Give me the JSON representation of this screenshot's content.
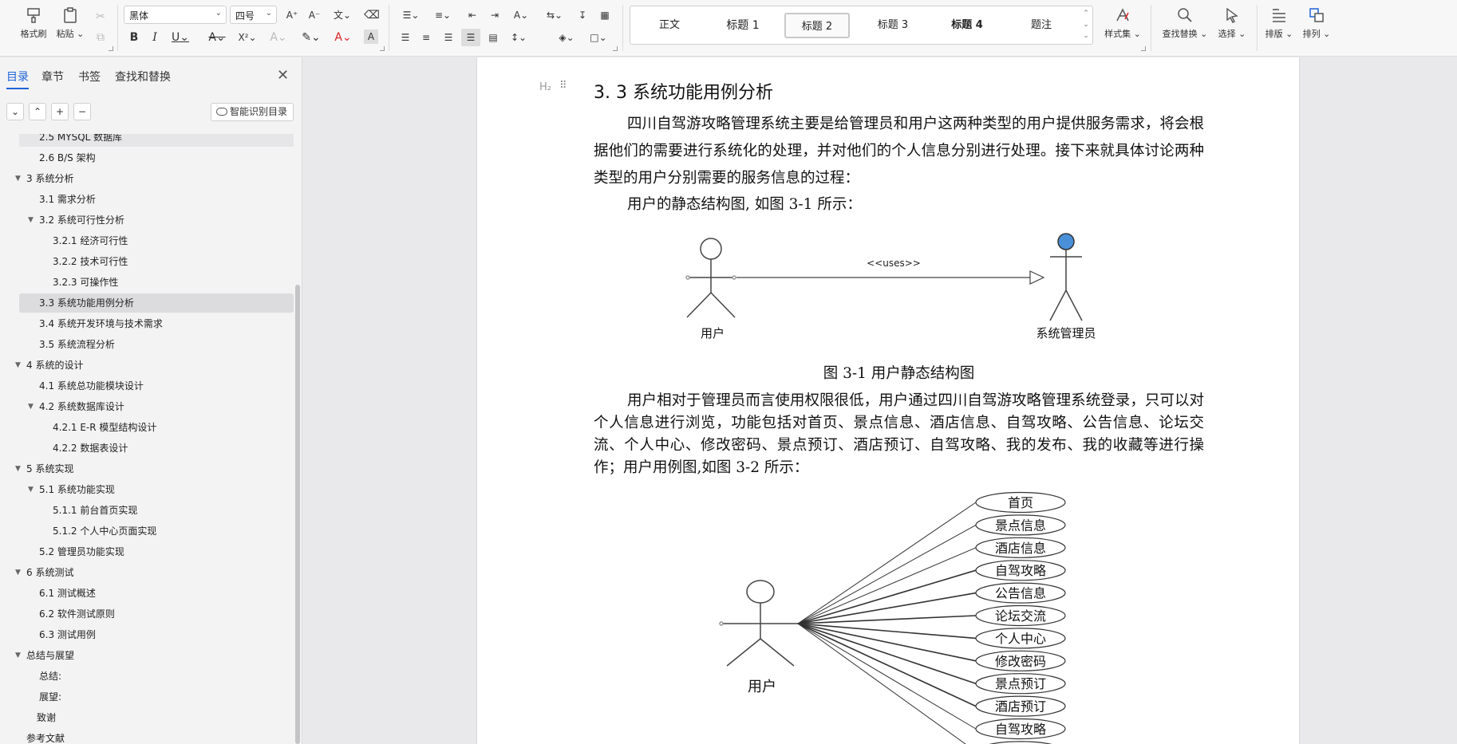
{
  "ribbon": {
    "format_painter": "格式刷",
    "paste": "粘贴",
    "font_name": "黑体",
    "font_size": "四号",
    "styles": [
      "正文",
      "标题 1",
      "标题 2",
      "标题 3",
      "标题 4",
      "题注"
    ],
    "active_style": "标题 2",
    "style_set": "样式集",
    "find_replace": "查找替换",
    "select": "选择",
    "layout": "排版",
    "arrange": "排列"
  },
  "nav": {
    "tabs": [
      "目录",
      "章节",
      "书签",
      "查找和替换"
    ],
    "active_tab": "目录",
    "smart_toc": "智能识别目录",
    "items": [
      {
        "label": "2.5 MYSQL 数据库",
        "level": 2,
        "caret": false,
        "partial": true
      },
      {
        "label": "2.6 B/S 架构",
        "level": 2,
        "caret": false
      },
      {
        "label": "3   系统分析",
        "level": 1,
        "caret": true
      },
      {
        "label": "3.1 需求分析",
        "level": 2,
        "caret": false
      },
      {
        "label": "3.2  系统可行性分析",
        "level": 2,
        "caret": true
      },
      {
        "label": "3.2.1 经济可行性",
        "level": 3,
        "caret": false
      },
      {
        "label": "3.2.2 技术可行性",
        "level": 3,
        "caret": false
      },
      {
        "label": "3.2.3 可操作性",
        "level": 3,
        "caret": false
      },
      {
        "label": "3.3 系统功能用例分析",
        "level": 2,
        "caret": false,
        "selected": true
      },
      {
        "label": "3.4 系统开发环境与技术需求",
        "level": 2,
        "caret": false
      },
      {
        "label": "3.5 系统流程分析",
        "level": 2,
        "caret": false
      },
      {
        "label": "4   系统的设计",
        "level": 1,
        "caret": true
      },
      {
        "label": "4.1 系统总功能模块设计",
        "level": 2,
        "caret": false
      },
      {
        "label": "4.2 系统数据库设计",
        "level": 2,
        "caret": true
      },
      {
        "label": "4.2.1 E-R 模型结构设计",
        "level": 3,
        "caret": false
      },
      {
        "label": "4.2.2 数据表设计",
        "level": 3,
        "caret": false
      },
      {
        "label": "5 系统实现",
        "level": 1,
        "caret": true
      },
      {
        "label": "5.1 系统功能实现",
        "level": 2,
        "caret": true
      },
      {
        "label": "5.1.1 前台首页实现",
        "level": 3,
        "caret": false
      },
      {
        "label": "5.1.2 个人中心页面实现",
        "level": 3,
        "caret": false
      },
      {
        "label": "5.2 管理员功能实现",
        "level": 2,
        "caret": false
      },
      {
        "label": "6 系统测试",
        "level": 1,
        "caret": true
      },
      {
        "label": "6.1 测试概述",
        "level": 2,
        "caret": false
      },
      {
        "label": "6.2 软件测试原则",
        "level": 2,
        "caret": false
      },
      {
        "label": "6.3 测试用例",
        "level": 2,
        "caret": false
      },
      {
        "label": "总结与展望",
        "level": 1,
        "caret": true
      },
      {
        "label": "总结:",
        "level": 2,
        "caret": false
      },
      {
        "label": "展望:",
        "level": 2,
        "caret": false
      },
      {
        "label": "致谢",
        "level": 1.5,
        "caret": false
      },
      {
        "label": "参考文献",
        "level": 1,
        "caret": false
      }
    ]
  },
  "doc": {
    "heading_marker": "H₂",
    "heading": "3. 3 系统功能用例分析",
    "para1": "四川自驾游攻略管理系统主要是给管理员和用户这两种类型的用户提供服务需求，将会根据他们的需要进行系统化的处理，并对他们的个人信息分别进行处理。接下来就具体讨论两种类型的用户分别需要的服务信息的过程：",
    "para2": "用户的静态结构图, 如图 3-1 所示：",
    "fig1": {
      "actor1": "用户",
      "actor2": "系统管理员",
      "relation": "<<uses>>",
      "actor2_color": "#4a90d9"
    },
    "caption1": "图 3-1  用户静态结构图",
    "para3": "用户相对于管理员而言使用权限很低，用户通过四川自驾游攻略管理系统登录，只可以对个人信息进行浏览，功能包括对首页、景点信息、酒店信息、自驾攻略、公告信息、论坛交流、个人中心、修改密码、景点预订、酒店预订、自驾攻略、我的发布、我的收藏等进行操作；用户用例图,如图 3-2 所示：",
    "fig2": {
      "actor": "用户",
      "use_cases": [
        "首页",
        "景点信息",
        "酒店信息",
        "自驾攻略",
        "公告信息",
        "论坛交流",
        "个人中心",
        "修改密码",
        "景点预订",
        "酒店预订",
        "自驾攻略",
        ""
      ]
    }
  }
}
